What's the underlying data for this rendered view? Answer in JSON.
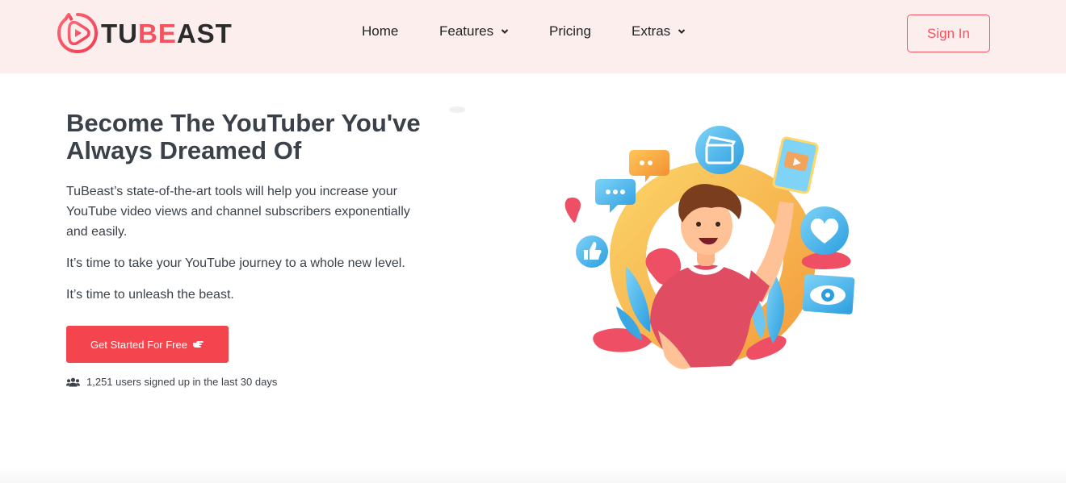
{
  "brand": {
    "name_part1": "TU",
    "name_part2": "BE",
    "name_part3": "AST",
    "accent_color": "#f4525f",
    "header_bg": "#fdeeee"
  },
  "nav": {
    "items": [
      {
        "label": "Home",
        "has_dropdown": false
      },
      {
        "label": "Features",
        "has_dropdown": true
      },
      {
        "label": "Pricing",
        "has_dropdown": false
      },
      {
        "label": "Extras",
        "has_dropdown": true
      }
    ],
    "signin_label": "Sign In"
  },
  "hero": {
    "headline": "Become The YouTuber You've Always Dreamed Of",
    "paragraph1": "TuBeast’s state-of-the-art tools will help you increase your YouTube video views and channel subscribers exponentially and easily.",
    "paragraph2": "It’s time to take your YouTube journey to a whole new level.",
    "paragraph3": "It’s time to unleash the beast.",
    "cta_label": "Get Started For Free",
    "cta_icon": "pointing-hand-icon",
    "social_proof": "1,251 users signed up in the last 30 days",
    "social_icon": "users-icon",
    "cta_color": "#f4454f"
  },
  "illustration": {
    "description_icons": [
      "chat-bubble-icon",
      "clapperboard-icon",
      "video-card-icon",
      "thumbs-up-icon",
      "heart-icon",
      "eye-icon"
    ]
  }
}
